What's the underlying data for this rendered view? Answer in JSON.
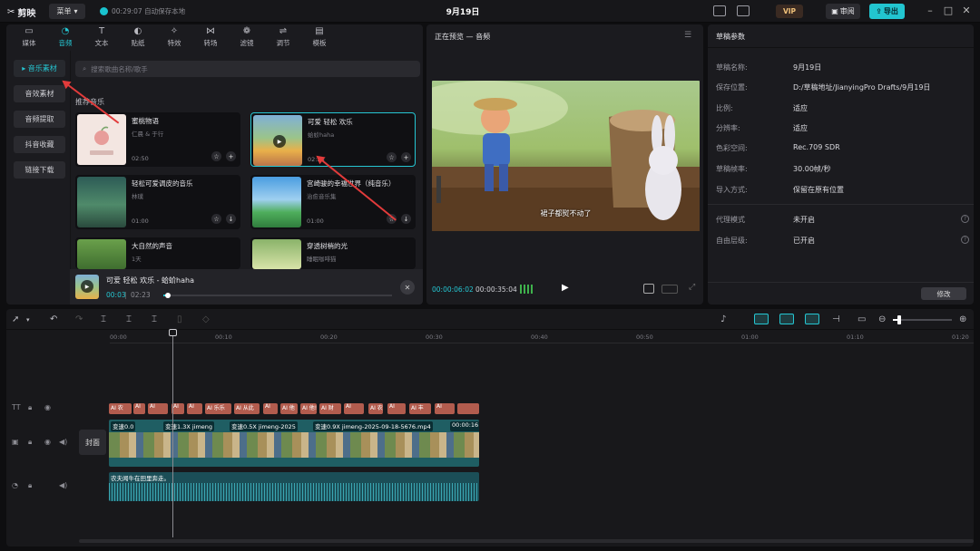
{
  "titlebar": {
    "app_name": "剪映",
    "menu_label": "菜单",
    "autosave": "00:29:07 自动保存本地",
    "doc_title": "9月19日",
    "vip_label": "VIP",
    "review_label": "审阅",
    "export_label": "导出"
  },
  "tabs": [
    {
      "label": "媒体",
      "icon": "media-icon"
    },
    {
      "label": "音频",
      "icon": "audio-icon"
    },
    {
      "label": "文本",
      "icon": "text-icon"
    },
    {
      "label": "贴纸",
      "icon": "sticker-icon"
    },
    {
      "label": "特效",
      "icon": "effects-icon"
    },
    {
      "label": "转场",
      "icon": "transition-icon"
    },
    {
      "label": "滤镜",
      "icon": "filter-icon"
    },
    {
      "label": "调节",
      "icon": "adjust-icon"
    },
    {
      "label": "模板",
      "icon": "template-icon"
    }
  ],
  "sidebar": [
    "音乐素材",
    "音效素材",
    "音频提取",
    "抖音收藏",
    "链接下载"
  ],
  "search": {
    "placeholder": "搜索歌曲名称/歌手"
  },
  "section_title": "推荐音乐",
  "cards": [
    {
      "title": "蜜桃物语",
      "sub": "仁晨 & 于行",
      "dur": "02:50"
    },
    {
      "title": "可爱 轻松 欢乐",
      "sub": "蛤蚧haha",
      "dur": "02:23"
    },
    {
      "title": "轻松可爱调皮的音乐",
      "sub": "林璞",
      "dur": "01:00"
    },
    {
      "title": "宫崎骏的幸福世界（纯音乐）",
      "sub": "治愈音乐集",
      "dur": "01:00"
    },
    {
      "title": "大自然的声音",
      "sub": "1天",
      "dur": ""
    },
    {
      "title": "穿透树梢的光",
      "sub": "睡眠咖啡猫",
      "dur": ""
    }
  ],
  "player": {
    "title": "可爱 轻松 欢乐 - 蛤蚧haha",
    "current": "00:03",
    "total": "02:23",
    "progress": 0.02
  },
  "preview": {
    "title": "正在预览 — 音频",
    "subtitle": "裙子都熨不动了",
    "current": "00:00:06:02",
    "total": "00:00:35:04"
  },
  "draft": {
    "title": "草稿参数",
    "rows": [
      {
        "k": "草稿名称:",
        "v": "9月19日"
      },
      {
        "k": "保存位置:",
        "v": "D:/草稿地址/JianyingPro Drafts/9月19日"
      },
      {
        "k": "比例:",
        "v": "适应"
      },
      {
        "k": "分辨率:",
        "v": "适应"
      },
      {
        "k": "色彩空间:",
        "v": "Rec.709 SDR"
      },
      {
        "k": "草稿帧率:",
        "v": "30.00帧/秒"
      },
      {
        "k": "导入方式:",
        "v": "保留在原有位置"
      },
      {
        "k": "代理模式",
        "v": "未开启"
      },
      {
        "k": "自由层级:",
        "v": "已开启"
      }
    ],
    "modify_label": "修改"
  },
  "timeline": {
    "ticks": [
      "00:00",
      "00:10",
      "00:20",
      "00:30",
      "00:40",
      "00:50",
      "01:00",
      "01:10",
      "01:20"
    ],
    "cover_label": "封面",
    "text_clips": [
      "AI 农",
      "AI",
      "AI",
      "AI",
      "AI",
      "AI 乐乐",
      "AI 从此",
      "AI",
      "AI 他",
      "AI 他!",
      "AI 财",
      "AI",
      "AI 农",
      "AI",
      "AI 丰",
      "AI"
    ],
    "video_segments": [
      "变速0.0",
      "变速1.3X jimeng",
      "变速0.5X jimeng-2025",
      "变速0.9X jimeng-2025-09-18-5676.mp4",
      "00:00:16"
    ],
    "audio_label": "农夫闻牛在田里奔走。"
  }
}
